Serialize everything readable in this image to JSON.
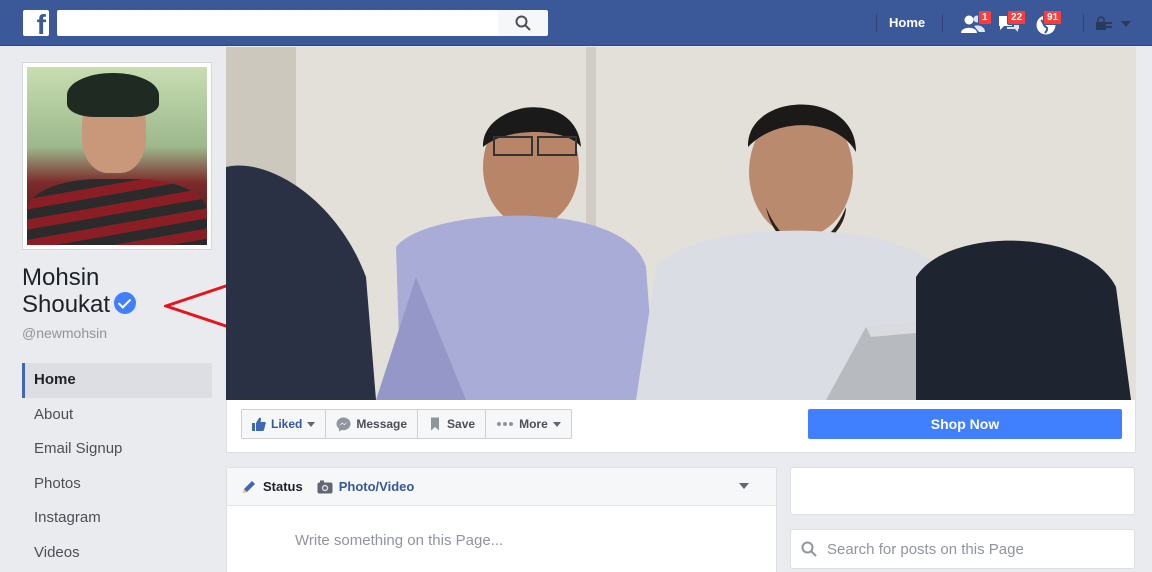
{
  "topbar": {
    "logo_letter": "f",
    "search_placeholder": "",
    "home_label": "Home",
    "friend_requests_count": "1",
    "messages_count": "22",
    "notifications_count": "91"
  },
  "page": {
    "name_line1": "Mohsin",
    "name_line2": "Shoukat",
    "handle": "@newmohsin"
  },
  "nav": {
    "items": [
      {
        "label": "Home",
        "active": true
      },
      {
        "label": "About"
      },
      {
        "label": "Email Signup"
      },
      {
        "label": "Photos"
      },
      {
        "label": "Instagram"
      },
      {
        "label": "Videos"
      }
    ]
  },
  "actions": {
    "liked": "Liked",
    "message": "Message",
    "save": "Save",
    "more": "More",
    "shop_now": "Shop Now"
  },
  "composer": {
    "status_tab": "Status",
    "photo_tab": "Photo/Video",
    "placeholder": "Write something on this Page..."
  },
  "right": {
    "search_placeholder": "Search for posts on this Page"
  },
  "colors": {
    "topbar": "#3b5998",
    "accent": "#4080ff",
    "badge": "#fa3e3e",
    "annotation_arrow": "#e8141c"
  }
}
